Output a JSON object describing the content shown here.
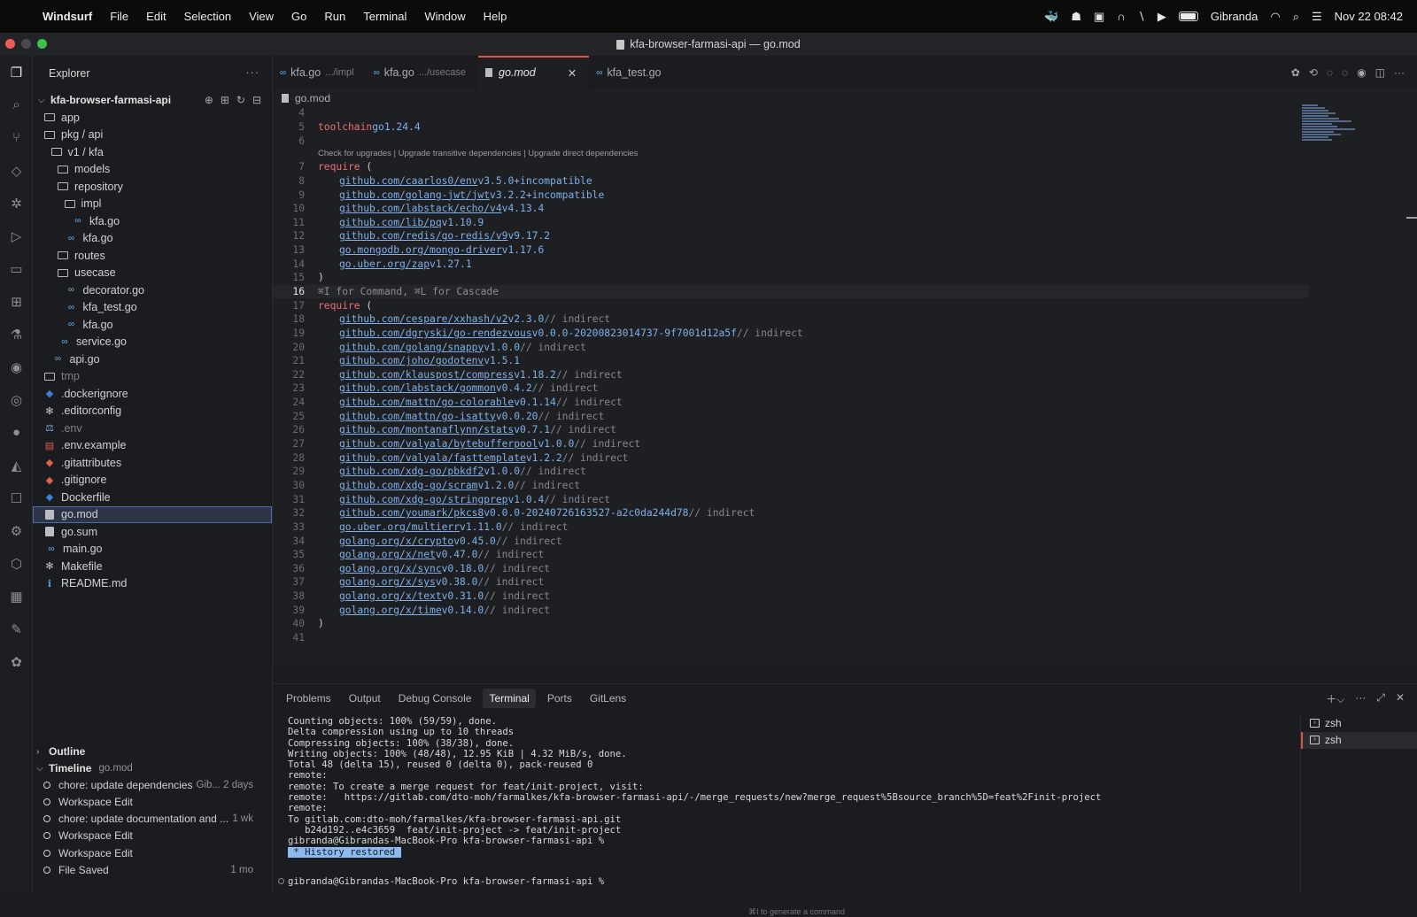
{
  "menubar": {
    "app": "Windsurf",
    "items": [
      "File",
      "Edit",
      "Selection",
      "View",
      "Go",
      "Run",
      "Terminal",
      "Window",
      "Help"
    ],
    "user": "Gibranda",
    "datetime": "Nov 22  08:42"
  },
  "window": {
    "title": "kfa-browser-farmasi-api — go.mod"
  },
  "explorer": {
    "title": "Explorer",
    "project": "kfa-browser-farmasi-api",
    "tree": [
      {
        "label": "app",
        "depth": 0,
        "icon": "folder"
      },
      {
        "label": "pkg / api",
        "depth": 0,
        "icon": "folder"
      },
      {
        "label": "v1 / kfa",
        "depth": 1,
        "icon": "folder"
      },
      {
        "label": "models",
        "depth": 2,
        "icon": "folder"
      },
      {
        "label": "repository",
        "depth": 2,
        "icon": "folder"
      },
      {
        "label": "impl",
        "depth": 3,
        "icon": "folder"
      },
      {
        "label": "kfa.go",
        "depth": 4,
        "icon": "go"
      },
      {
        "label": "kfa.go",
        "depth": 3,
        "icon": "go"
      },
      {
        "label": "routes",
        "depth": 2,
        "icon": "folder"
      },
      {
        "label": "usecase",
        "depth": 2,
        "icon": "folder"
      },
      {
        "label": "decorator.go",
        "depth": 3,
        "icon": "go"
      },
      {
        "label": "kfa_test.go",
        "depth": 3,
        "icon": "go"
      },
      {
        "label": "kfa.go",
        "depth": 3,
        "icon": "go"
      },
      {
        "label": "service.go",
        "depth": 2,
        "icon": "go"
      },
      {
        "label": "api.go",
        "depth": 1,
        "icon": "go"
      },
      {
        "label": "tmp",
        "depth": 0,
        "icon": "folder",
        "dim": true
      },
      {
        "label": ".dockerignore",
        "depth": 0,
        "icon": "docker"
      },
      {
        "label": ".editorconfig",
        "depth": 0,
        "icon": "gear"
      },
      {
        "label": ".env",
        "depth": 0,
        "icon": "env",
        "dim": true
      },
      {
        "label": ".env.example",
        "depth": 0,
        "icon": "env2"
      },
      {
        "label": ".gitattributes",
        "depth": 0,
        "icon": "git"
      },
      {
        "label": ".gitignore",
        "depth": 0,
        "icon": "git"
      },
      {
        "label": "Dockerfile",
        "depth": 0,
        "icon": "docker"
      },
      {
        "label": "go.mod",
        "depth": 0,
        "icon": "mod",
        "selected": true
      },
      {
        "label": "go.sum",
        "depth": 0,
        "icon": "mod"
      },
      {
        "label": "main.go",
        "depth": 0,
        "icon": "go"
      },
      {
        "label": "Makefile",
        "depth": 0,
        "icon": "gear"
      },
      {
        "label": "README.md",
        "depth": 0,
        "icon": "info"
      }
    ],
    "outline_label": "Outline",
    "timeline_label": "Timeline",
    "timeline_file": "go.mod",
    "timeline": [
      {
        "label": "chore: update dependencies",
        "meta": "Gib...  2 days"
      },
      {
        "label": "Workspace Edit",
        "meta": ""
      },
      {
        "label": "chore: update documentation and ...",
        "meta": "1 wk"
      },
      {
        "label": "Workspace Edit",
        "meta": ""
      },
      {
        "label": "Workspace Edit",
        "meta": ""
      },
      {
        "label": "File Saved",
        "meta": "1 mo"
      }
    ]
  },
  "editor": {
    "tabs": [
      {
        "label": "kfa.go",
        "path": ".../impl",
        "icon": "go"
      },
      {
        "label": "kfa.go",
        "path": ".../usecase",
        "icon": "go"
      },
      {
        "label": "go.mod",
        "path": "",
        "icon": "mod",
        "active": true
      },
      {
        "label": "kfa_test.go",
        "path": "",
        "icon": "go"
      }
    ],
    "breadcrumb": "go.mod",
    "codelens": "Check for upgrades | Upgrade transitive dependencies | Upgrade direct dependencies",
    "hint": "⌘I for Command, ⌘L for Cascade",
    "toolchain": {
      "kw": "toolchain",
      "val": "go1.24.4"
    },
    "require_kw": "require",
    "direct_deps": [
      {
        "mod": "github.com/caarlos0/env",
        "ver": "v3.5.0+incompatible"
      },
      {
        "mod": "github.com/golang-jwt/jwt",
        "ver": "v3.2.2+incompatible"
      },
      {
        "mod": "github.com/labstack/echo/v4",
        "ver": "v4.13.4"
      },
      {
        "mod": "github.com/lib/pq",
        "ver": "v1.10.9"
      },
      {
        "mod": "github.com/redis/go-redis/v9",
        "ver": "v9.17.2"
      },
      {
        "mod": "go.mongodb.org/mongo-driver",
        "ver": "v1.17.6"
      },
      {
        "mod": "go.uber.org/zap",
        "ver": "v1.27.1"
      }
    ],
    "indirect_comment": "// indirect",
    "indirect_deps": [
      {
        "mod": "github.com/cespare/xxhash/v2",
        "ver": "v2.3.0"
      },
      {
        "mod": "github.com/dgryski/go-rendezvous",
        "ver": "v0.0.0-20200823014737-9f7001d12a5f"
      },
      {
        "mod": "github.com/golang/snappy",
        "ver": "v1.0.0"
      },
      {
        "mod": "github.com/joho/godotenv",
        "ver": "v1.5.1",
        "nocomment": true
      },
      {
        "mod": "github.com/klauspost/compress",
        "ver": "v1.18.2"
      },
      {
        "mod": "github.com/labstack/gommon",
        "ver": "v0.4.2"
      },
      {
        "mod": "github.com/mattn/go-colorable",
        "ver": "v0.1.14"
      },
      {
        "mod": "github.com/mattn/go-isatty",
        "ver": "v0.0.20"
      },
      {
        "mod": "github.com/montanaflynn/stats",
        "ver": "v0.7.1"
      },
      {
        "mod": "github.com/valyala/bytebufferpool",
        "ver": "v1.0.0"
      },
      {
        "mod": "github.com/valyala/fasttemplate",
        "ver": "v1.2.2"
      },
      {
        "mod": "github.com/xdg-go/pbkdf2",
        "ver": "v1.0.0"
      },
      {
        "mod": "github.com/xdg-go/scram",
        "ver": "v1.2.0"
      },
      {
        "mod": "github.com/xdg-go/stringprep",
        "ver": "v1.0.4"
      },
      {
        "mod": "github.com/youmark/pkcs8",
        "ver": "v0.0.0-20240726163527-a2c0da244d78"
      },
      {
        "mod": "go.uber.org/multierr",
        "ver": "v1.11.0"
      },
      {
        "mod": "golang.org/x/crypto",
        "ver": "v0.45.0"
      },
      {
        "mod": "golang.org/x/net",
        "ver": "v0.47.0"
      },
      {
        "mod": "golang.org/x/sync",
        "ver": "v0.18.0"
      },
      {
        "mod": "golang.org/x/sys",
        "ver": "v0.38.0"
      },
      {
        "mod": "golang.org/x/text",
        "ver": "v0.31.0"
      },
      {
        "mod": "golang.org/x/time",
        "ver": "v0.14.0"
      }
    ],
    "first_line_number": 4,
    "current_line": 16
  },
  "panel": {
    "tabs": [
      "Problems",
      "Output",
      "Debug Console",
      "Terminal",
      "Ports",
      "GitLens"
    ],
    "active_tab": "Terminal",
    "terminal_lines": [
      "Counting objects: 100% (59/59), done.",
      "Delta compression using up to 10 threads",
      "Compressing objects: 100% (38/38), done.",
      "Writing objects: 100% (48/48), 12.95 KiB | 4.32 MiB/s, done.",
      "Total 48 (delta 15), reused 0 (delta 0), pack-reused 0",
      "remote:",
      "remote: To create a merge request for feat/init-project, visit:",
      "remote:   https://gitlab.com/dto-moh/farmalkes/kfa-browser-farmasi-api/-/merge_requests/new?merge_request%5Bsource_branch%5D=feat%2Finit-project",
      "remote:",
      "To gitlab.com:dto-moh/farmalkes/kfa-browser-farmasi-api.git",
      "   b24d192..e4c3659  feat/init-project -> feat/init-project",
      "gibranda@Gibrandas-MacBook-Pro kfa-browser-farmasi-api %"
    ],
    "history_restored": " * History restored ",
    "prompt": "gibranda@Gibrandas-MacBook-Pro kfa-browser-farmasi-api %",
    "footer_hint": "⌘I to generate a command",
    "shells": [
      "zsh",
      "zsh"
    ]
  }
}
